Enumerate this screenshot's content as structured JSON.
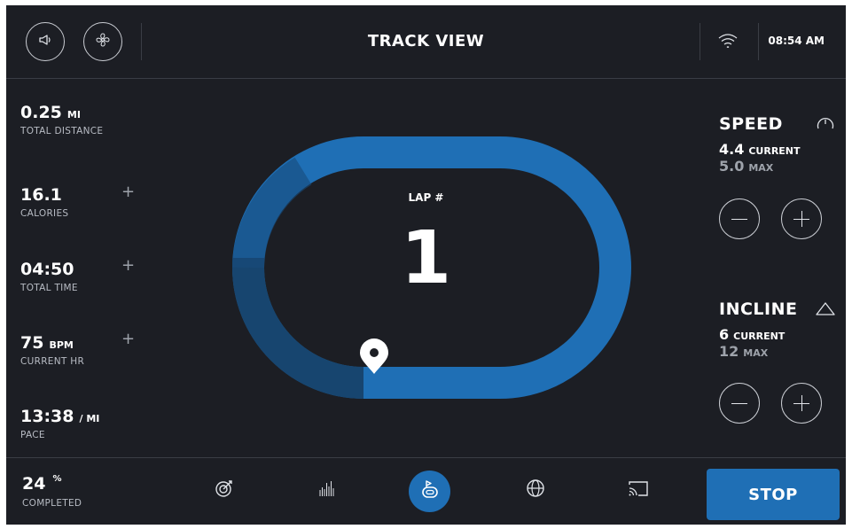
{
  "header": {
    "title": "TRACK VIEW",
    "time": "08:54 AM",
    "icons": [
      "speaker-icon",
      "fan-icon",
      "wifi-icon"
    ]
  },
  "stats": [
    {
      "value": "0.25",
      "unit": "MI",
      "label": "TOTAL DISTANCE",
      "adjustable": false
    },
    {
      "value": "16.1",
      "unit": "",
      "label": "CALORIES",
      "adjustable": true
    },
    {
      "value": "04:50",
      "unit": "",
      "label": "TOTAL TIME",
      "adjustable": true
    },
    {
      "value": "75",
      "unit": "BPM",
      "label": "CURRENT HR",
      "adjustable": true
    },
    {
      "value": "13:38",
      "unit": "/ MI",
      "label": "PACE",
      "adjustable": false
    }
  ],
  "track": {
    "lap_label": "LAP #",
    "lap_number": "1",
    "colors": {
      "track": "#1f6fb5",
      "track_dark": "#163e63",
      "marker": "#ffffff"
    }
  },
  "speed": {
    "title": "SPEED",
    "current": "4.4",
    "current_label": "CURRENT",
    "max": "5.0",
    "max_label": "MAX"
  },
  "incline": {
    "title": "INCLINE",
    "current": "6",
    "current_label": "CURRENT",
    "max": "12",
    "max_label": "MAX"
  },
  "footer": {
    "progress_value": "24",
    "progress_unit": "%",
    "progress_label": "COMPLETED",
    "stop_label": "STOP",
    "nav_icons": [
      "target-icon",
      "bar-chart-icon",
      "track-icon",
      "globe-icon",
      "cast-icon"
    ],
    "active_nav": "track-icon"
  },
  "colors": {
    "background": "#1c1e24",
    "accent": "#1f6fb5",
    "text": "#ffffff",
    "muted": "#b8bcc4"
  }
}
